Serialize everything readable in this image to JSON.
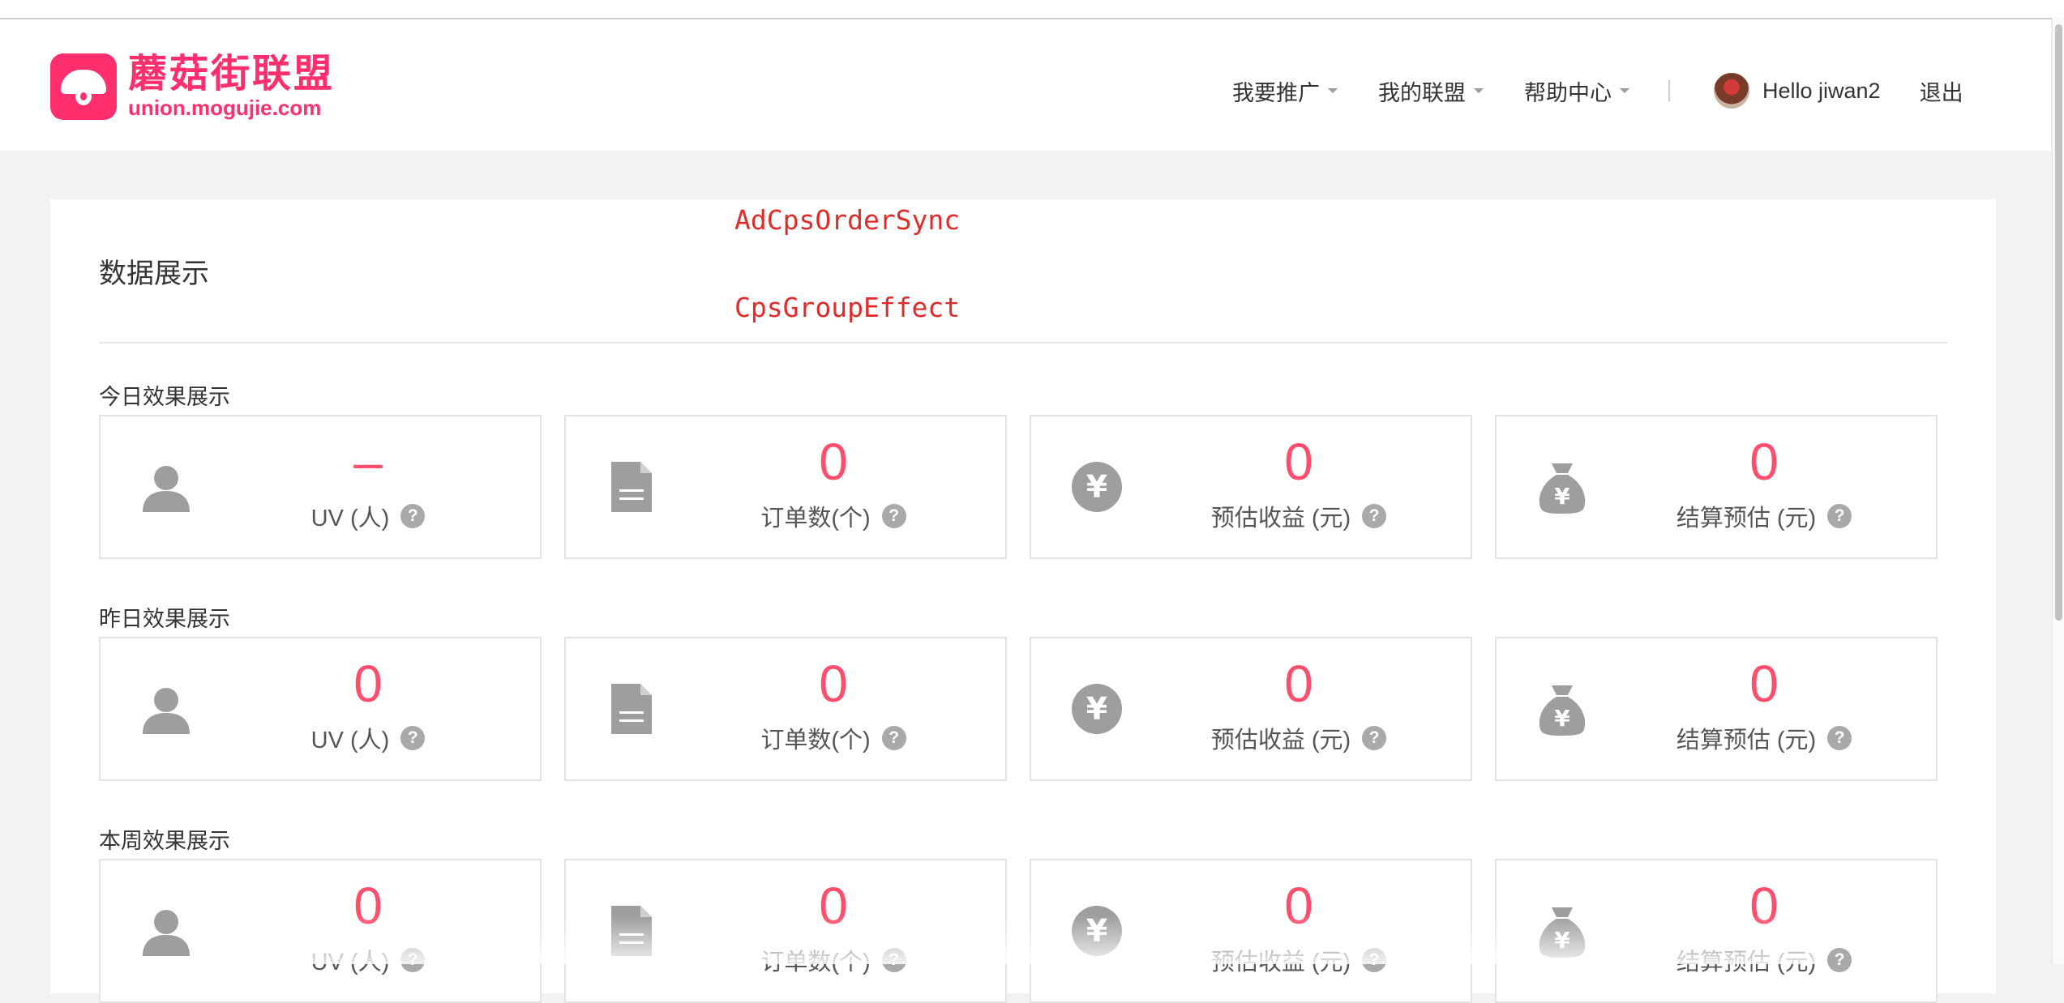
{
  "brand": {
    "name_cn": "蘑菇街联盟",
    "domain": "union.mogujie.com",
    "color": "#ff2f6e"
  },
  "nav": {
    "items": [
      {
        "label": "我要推广"
      },
      {
        "label": "我的联盟"
      },
      {
        "label": "帮助中心"
      }
    ],
    "greeting": "Hello jiwan2",
    "logout": "退出"
  },
  "main": {
    "title": "数据展示",
    "code_labels": [
      "AdCpsOrderSync",
      "CpsGroupEffect"
    ],
    "value_color": "#ff4d6d",
    "sections": [
      {
        "label": "今日效果展示",
        "stats": [
          {
            "icon": "user-icon",
            "value": "–",
            "label": "UV (人)"
          },
          {
            "icon": "document-icon",
            "value": "0",
            "label": "订单数(个)"
          },
          {
            "icon": "yen-coin-icon",
            "value": "0",
            "label": "预估收益 (元)"
          },
          {
            "icon": "money-bag-icon",
            "value": "0",
            "label": "结算预估 (元)"
          }
        ]
      },
      {
        "label": "昨日效果展示",
        "stats": [
          {
            "icon": "user-icon",
            "value": "0",
            "label": "UV (人)"
          },
          {
            "icon": "document-icon",
            "value": "0",
            "label": "订单数(个)"
          },
          {
            "icon": "yen-coin-icon",
            "value": "0",
            "label": "预估收益 (元)"
          },
          {
            "icon": "money-bag-icon",
            "value": "0",
            "label": "结算预估 (元)"
          }
        ]
      },
      {
        "label": "本周效果展示",
        "stats": [
          {
            "icon": "user-icon",
            "value": "0",
            "label": "UV (人)"
          },
          {
            "icon": "document-icon",
            "value": "0",
            "label": "订单数(个)"
          },
          {
            "icon": "yen-coin-icon",
            "value": "0",
            "label": "预估收益 (元)"
          },
          {
            "icon": "money-bag-icon",
            "value": "0",
            "label": "结算预估 (元)"
          }
        ]
      }
    ]
  }
}
